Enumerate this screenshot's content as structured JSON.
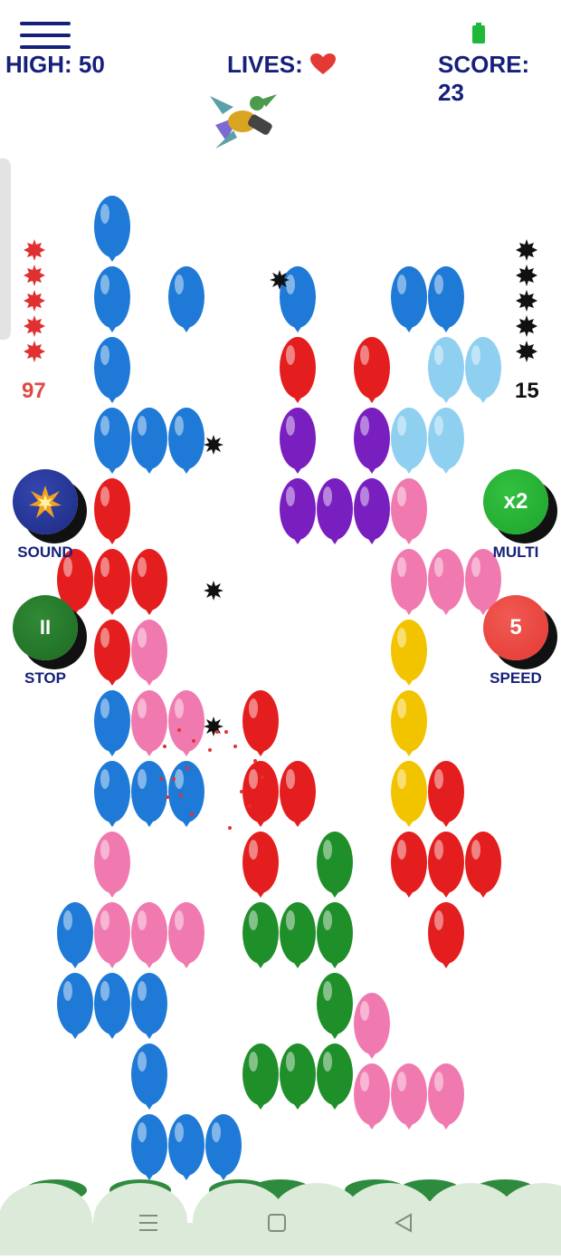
{
  "hud": {
    "high_label": "HIGH: 50",
    "lives_label": "LIVES:",
    "lives_icon": "heart-icon",
    "score_label": "SCORE: 23"
  },
  "left_counter": {
    "value": "97",
    "icon": "red-spiky-mine-icon",
    "count": 5,
    "color": "#e04848"
  },
  "right_counter": {
    "value": "15",
    "icon": "black-spiky-mine-icon",
    "count": 5,
    "color": "#111111"
  },
  "buttons": {
    "sound": {
      "label": "SOUND",
      "icon": "explosion-icon",
      "color": "#1c2a80"
    },
    "stop": {
      "label": "STOP",
      "icon_text": "II",
      "color": "#1e6a24"
    },
    "multi": {
      "label": "MULTI",
      "value": "x2",
      "color": "#1fa42d"
    },
    "speed": {
      "label": "SPEED",
      "value": "5",
      "color": "#e53935"
    }
  },
  "colors": {
    "text": "#16207a",
    "blue": "#1e7ad6",
    "lightblue": "#8fd0f0",
    "red": "#e41e1e",
    "purple": "#7a1fbf",
    "pink": "#f07ab0",
    "yellow": "#f2c400",
    "green": "#1f8f2a"
  },
  "status": {
    "battery_icon": "battery-charging-icon"
  },
  "nav": {
    "recent_icon": "recents-icon",
    "home_icon": "home-icon",
    "back_icon": "back-icon"
  }
}
